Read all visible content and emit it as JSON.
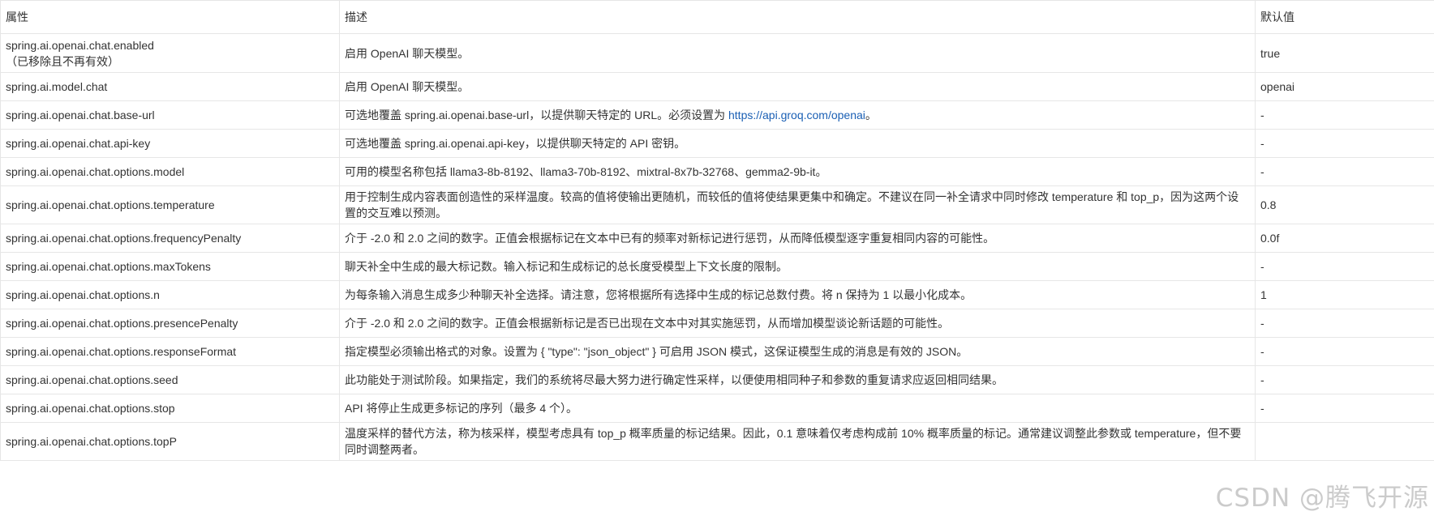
{
  "table": {
    "headers": [
      "属性",
      "描述",
      "默认值"
    ],
    "rows": [
      {
        "prop": "spring.ai.openai.chat.enabled",
        "prop_note": "（已移除且不再有效）",
        "desc": "启用 OpenAI 聊天模型。",
        "default": "true"
      },
      {
        "prop": "spring.ai.model.chat",
        "desc": "启用 OpenAI 聊天模型。",
        "default": "openai"
      },
      {
        "prop": "spring.ai.openai.chat.base-url",
        "desc": "可选地覆盖 spring.ai.openai.base-url，以提供聊天特定的 URL。必须设置为 ",
        "desc_link": "https://api.groq.com/openai",
        "desc_after": "。",
        "default": "-"
      },
      {
        "prop": "spring.ai.openai.chat.api-key",
        "desc": "可选地覆盖 spring.ai.openai.api-key，以提供聊天特定的 API 密钥。",
        "default": "-"
      },
      {
        "prop": "spring.ai.openai.chat.options.model",
        "desc": "可用的模型名称包括 llama3-8b-8192、llama3-70b-8192、mixtral-8x7b-32768、gemma2-9b-it。",
        "default": "-"
      },
      {
        "prop": "spring.ai.openai.chat.options.temperature",
        "desc": "用于控制生成内容表面创造性的采样温度。较高的值将使输出更随机，而较低的值将使结果更集中和确定。不建议在同一补全请求中同时修改 temperature 和 top_p，因为这两个设置的交互难以预测。",
        "default": "0.8"
      },
      {
        "prop": "spring.ai.openai.chat.options.frequencyPenalty",
        "desc": "介于 -2.0 和 2.0 之间的数字。正值会根据标记在文本中已有的频率对新标记进行惩罚，从而降低模型逐字重复相同内容的可能性。",
        "default": "0.0f"
      },
      {
        "prop": "spring.ai.openai.chat.options.maxTokens",
        "desc": "聊天补全中生成的最大标记数。输入标记和生成标记的总长度受模型上下文长度的限制。",
        "default": "-"
      },
      {
        "prop": "spring.ai.openai.chat.options.n",
        "desc": "为每条输入消息生成多少种聊天补全选择。请注意，您将根据所有选择中生成的标记总数付费。将 n 保持为 1 以最小化成本。",
        "default": "1"
      },
      {
        "prop": "spring.ai.openai.chat.options.presencePenalty",
        "desc": "介于 -2.0 和 2.0 之间的数字。正值会根据新标记是否已出现在文本中对其实施惩罚，从而增加模型谈论新话题的可能性。",
        "default": "-"
      },
      {
        "prop": "spring.ai.openai.chat.options.responseFormat",
        "desc": "指定模型必须输出格式的对象。设置为 { \"type\": \"json_object\" } 可启用 JSON 模式，这保证模型生成的消息是有效的 JSON。",
        "default": "-"
      },
      {
        "prop": "spring.ai.openai.chat.options.seed",
        "desc": "此功能处于测试阶段。如果指定，我们的系统将尽最大努力进行确定性采样，以便使用相同种子和参数的重复请求应返回相同结果。",
        "default": "-"
      },
      {
        "prop": "spring.ai.openai.chat.options.stop",
        "desc": "API 将停止生成更多标记的序列（最多 4 个）。",
        "default": "-"
      },
      {
        "prop": "spring.ai.openai.chat.options.topP",
        "desc": "温度采样的替代方法，称为核采样，模型考虑具有 top_p 概率质量的标记结果。因此，0.1 意味着仅考虑构成前 10% 概率质量的标记。通常建议调整此参数或 temperature，但不要同时调整两者。",
        "default": ""
      }
    ]
  },
  "watermark": "CSDN @腾飞开源"
}
